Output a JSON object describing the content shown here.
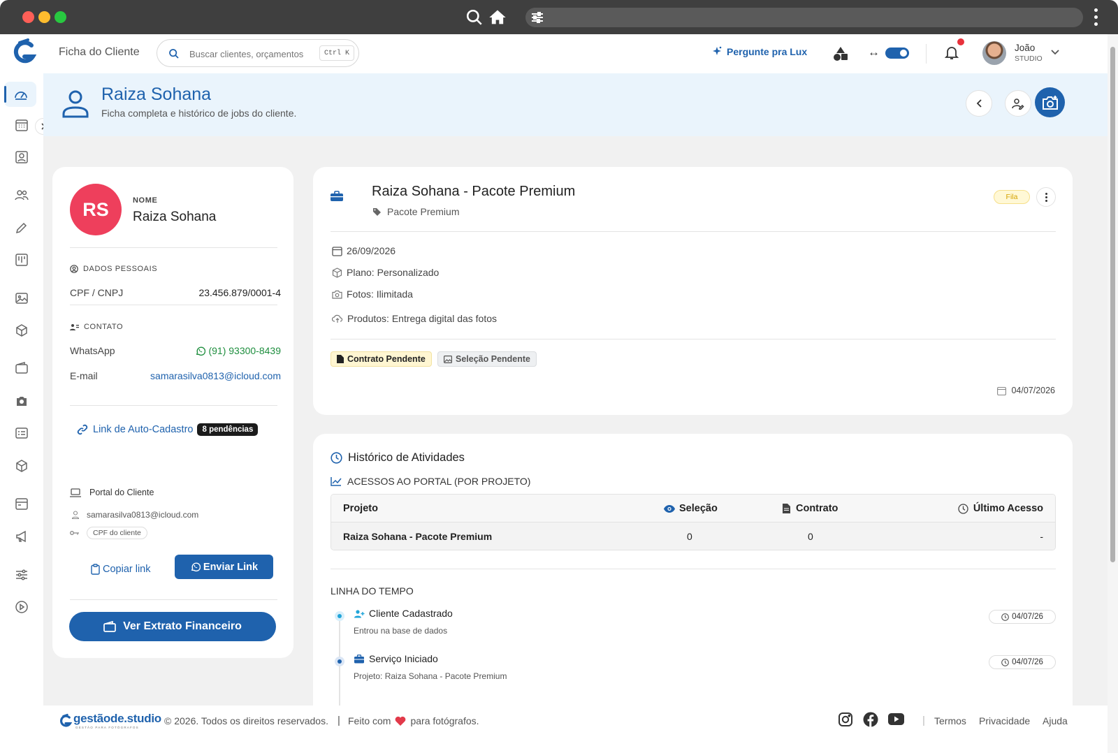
{
  "topbar": {
    "page_title": "Ficha do Cliente",
    "search_placeholder": "Buscar clientes, orçamentos",
    "search_shortcut": "Ctrl K",
    "ask_lux": "Pergunte pra Lux",
    "user_name": "João",
    "user_role": "STUDIO"
  },
  "header": {
    "title": "Raiza Sohana",
    "subtitle": "Ficha completa e histórico de jobs do cliente."
  },
  "client": {
    "initials": "RS",
    "name_label": "NOME",
    "name": "Raiza Sohana",
    "personal_section": "DADOS PESSOAIS",
    "cpf_label": "CPF / CNPJ",
    "cpf_value": "23.456.879/0001-4",
    "contact_section": "CONTATO",
    "whatsapp_label": "WhatsApp",
    "whatsapp_value": "(91) 93300-8439",
    "email_label": "E-mail",
    "email_value": "samarasilva0813@icloud.com",
    "autoreg_link": "Link de Auto-Cadastro",
    "pending_badge": "8 pendências",
    "portal_title": "Portal do Cliente",
    "portal_email": "samarasilva0813@icloud.com",
    "portal_password": "CPF do cliente",
    "copy_link": "Copiar link",
    "send_link": "Enviar Link",
    "statement_button": "Ver Extrato Financeiro"
  },
  "job": {
    "title": "Raiza Sohana - Pacote Premium",
    "tag": "Pacote Premium",
    "status": "Fila",
    "date": "26/09/2026",
    "plan": "Plano: Personalizado",
    "photos": "Fotos: Ilimitada",
    "products": "Produtos: Entrega digital das fotos",
    "contract_pill": "Contrato Pendente",
    "selection_pill": "Seleção Pendente",
    "created_date": "04/07/2026"
  },
  "history": {
    "title": "Histórico de Atividades",
    "portal_access_title": "ACESSOS AO PORTAL (POR PROJETO)",
    "columns": [
      "Projeto",
      "Seleção",
      "Contrato",
      "Último Acesso"
    ],
    "rows": [
      {
        "project": "Raiza Sohana - Pacote Premium",
        "selection": "0",
        "contract": "0",
        "last_access": "-"
      }
    ],
    "timeline_title": "LINHA DO TEMPO",
    "timeline": [
      {
        "title": "Cliente Cadastrado",
        "desc": "Entrou na base de dados",
        "date": "04/07/26"
      },
      {
        "title": "Serviço Iniciado",
        "desc": "Projeto: Raiza Sohana - Pacote Premium",
        "date": "04/07/26"
      }
    ]
  },
  "footer": {
    "brand": "gestãode.studio",
    "brand_tagline": "GESTÃO PARA FOTÓGRAFOS",
    "copyright": "© 2026. Todos os direitos reservados.",
    "made_with_prefix": "Feito com",
    "made_with_suffix": "para fotógrafos.",
    "links": [
      "Termos",
      "Privacidade",
      "Ajuda"
    ]
  },
  "colors": {
    "primary": "#1f62ad",
    "avatar_bg": "#ee3f5c",
    "whatsapp": "#1e8e3e",
    "header_bg": "#eaf4fc"
  }
}
